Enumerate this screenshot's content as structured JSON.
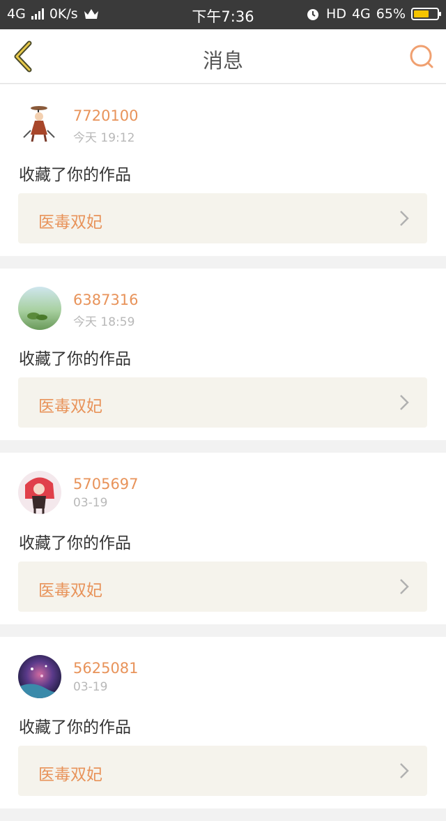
{
  "status_bar": {
    "network": "4G",
    "speed": "0K/s",
    "time": "下午7:36",
    "hd": "HD",
    "network2": "4G",
    "battery": "65%",
    "battery_level": 0.65
  },
  "header": {
    "title": "消息"
  },
  "messages": [
    {
      "user": "7720100",
      "time": "今天 19:12",
      "action": "收藏了你的作品",
      "work": "医毒双妃"
    },
    {
      "user": "6387316",
      "time": "今天 18:59",
      "action": "收藏了你的作品",
      "work": "医毒双妃"
    },
    {
      "user": "5705697",
      "time": "03-19",
      "action": "收藏了你的作品",
      "work": "医毒双妃"
    },
    {
      "user": "5625081",
      "time": "03-19",
      "action": "收藏了你的作品",
      "work": "医毒双妃"
    }
  ],
  "colors": {
    "accent": "#e8935a",
    "status_bar": "#3a3a3a",
    "card_bg": "#ffffff",
    "work_bg": "#f5f3ec"
  }
}
